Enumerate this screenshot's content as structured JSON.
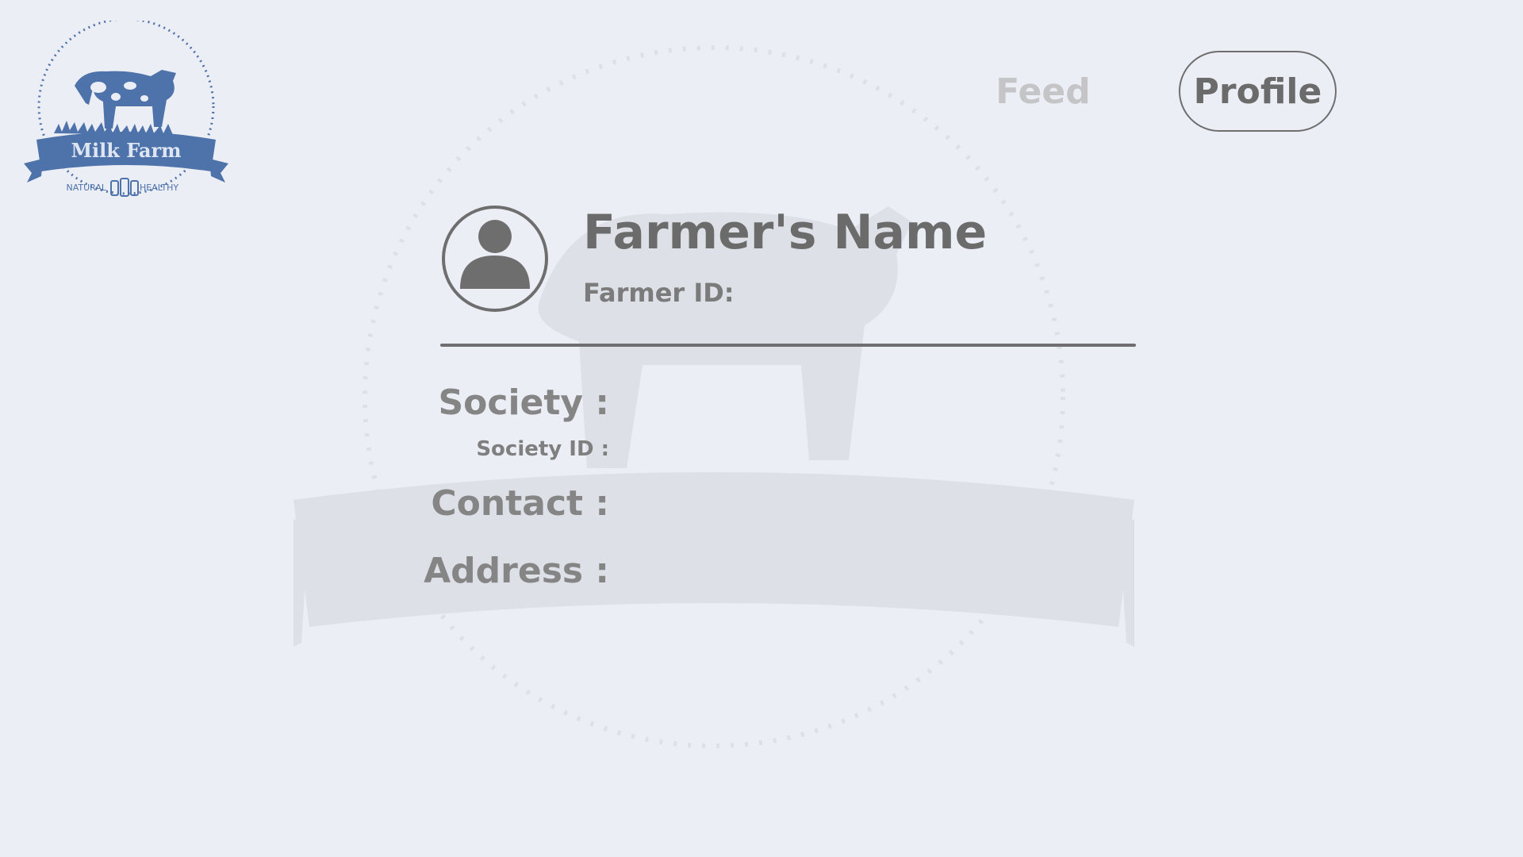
{
  "brand": {
    "name": "Milk Farm",
    "tagline_left": "NATURAL",
    "tagline_right": "HEALTHY",
    "color": "#4e72aa"
  },
  "nav": {
    "feed_label": "Feed",
    "profile_label": "Profile"
  },
  "profile": {
    "name": "Farmer's Name",
    "id_label": "Farmer ID:",
    "avatar_icon": "user-avatar-icon",
    "fields": {
      "society": "Society :",
      "society_id": "Society ID :",
      "contact": "Contact :",
      "address": "Address :"
    }
  },
  "colors": {
    "background": "#eceef6",
    "text_dark": "#6b6b6b",
    "text_muted": "#c5c5c7"
  }
}
